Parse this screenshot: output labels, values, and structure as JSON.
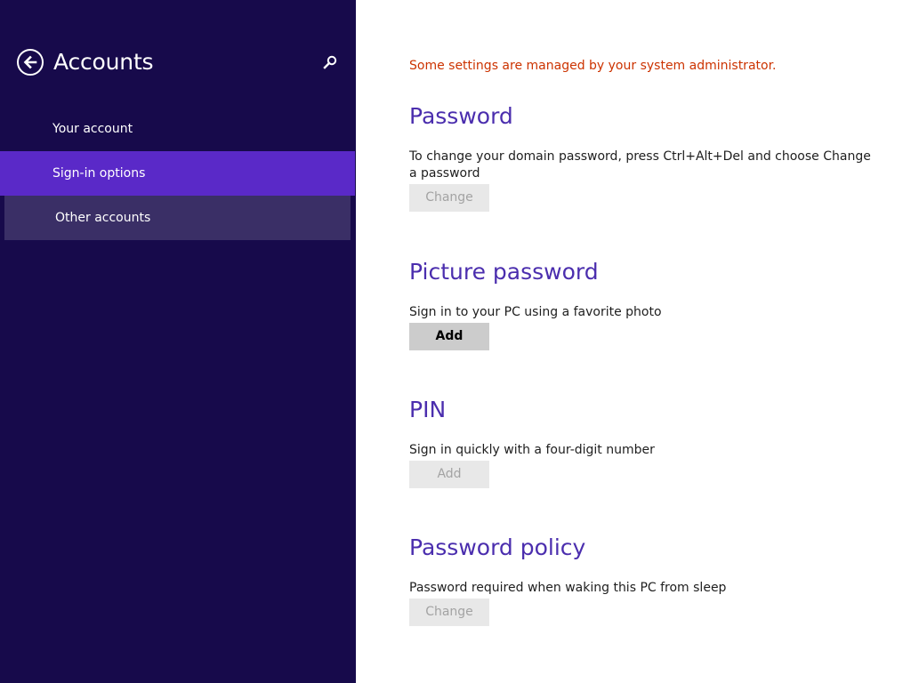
{
  "sidebar": {
    "title": "Accounts",
    "back_icon": "back-arrow-icon",
    "search_icon": "search-icon",
    "items": [
      {
        "label": "Your account",
        "state": "normal"
      },
      {
        "label": "Sign-in options",
        "state": "selected"
      },
      {
        "label": "Other accounts",
        "state": "hover"
      }
    ]
  },
  "main": {
    "notice": "Some settings are managed by your system administrator.",
    "sections": [
      {
        "title": "Password",
        "description": "To change your domain password, press Ctrl+Alt+Del and choose Change a password",
        "button": "Change",
        "button_enabled": false
      },
      {
        "title": "Picture password",
        "description": "Sign in to your PC using a favorite photo",
        "button": "Add",
        "button_enabled": true
      },
      {
        "title": "PIN",
        "description": "Sign in quickly with a four-digit number",
        "button": "Add",
        "button_enabled": false
      },
      {
        "title": "Password policy",
        "description": "Password required when waking this PC from sleep",
        "button": "Change",
        "button_enabled": false
      }
    ]
  },
  "colors": {
    "sidebar_bg": "#170a4b",
    "selected_bg": "#5a29c8",
    "hover_bg": "#3a2f66",
    "heading": "#4b2eae",
    "notice": "#cc3300"
  }
}
